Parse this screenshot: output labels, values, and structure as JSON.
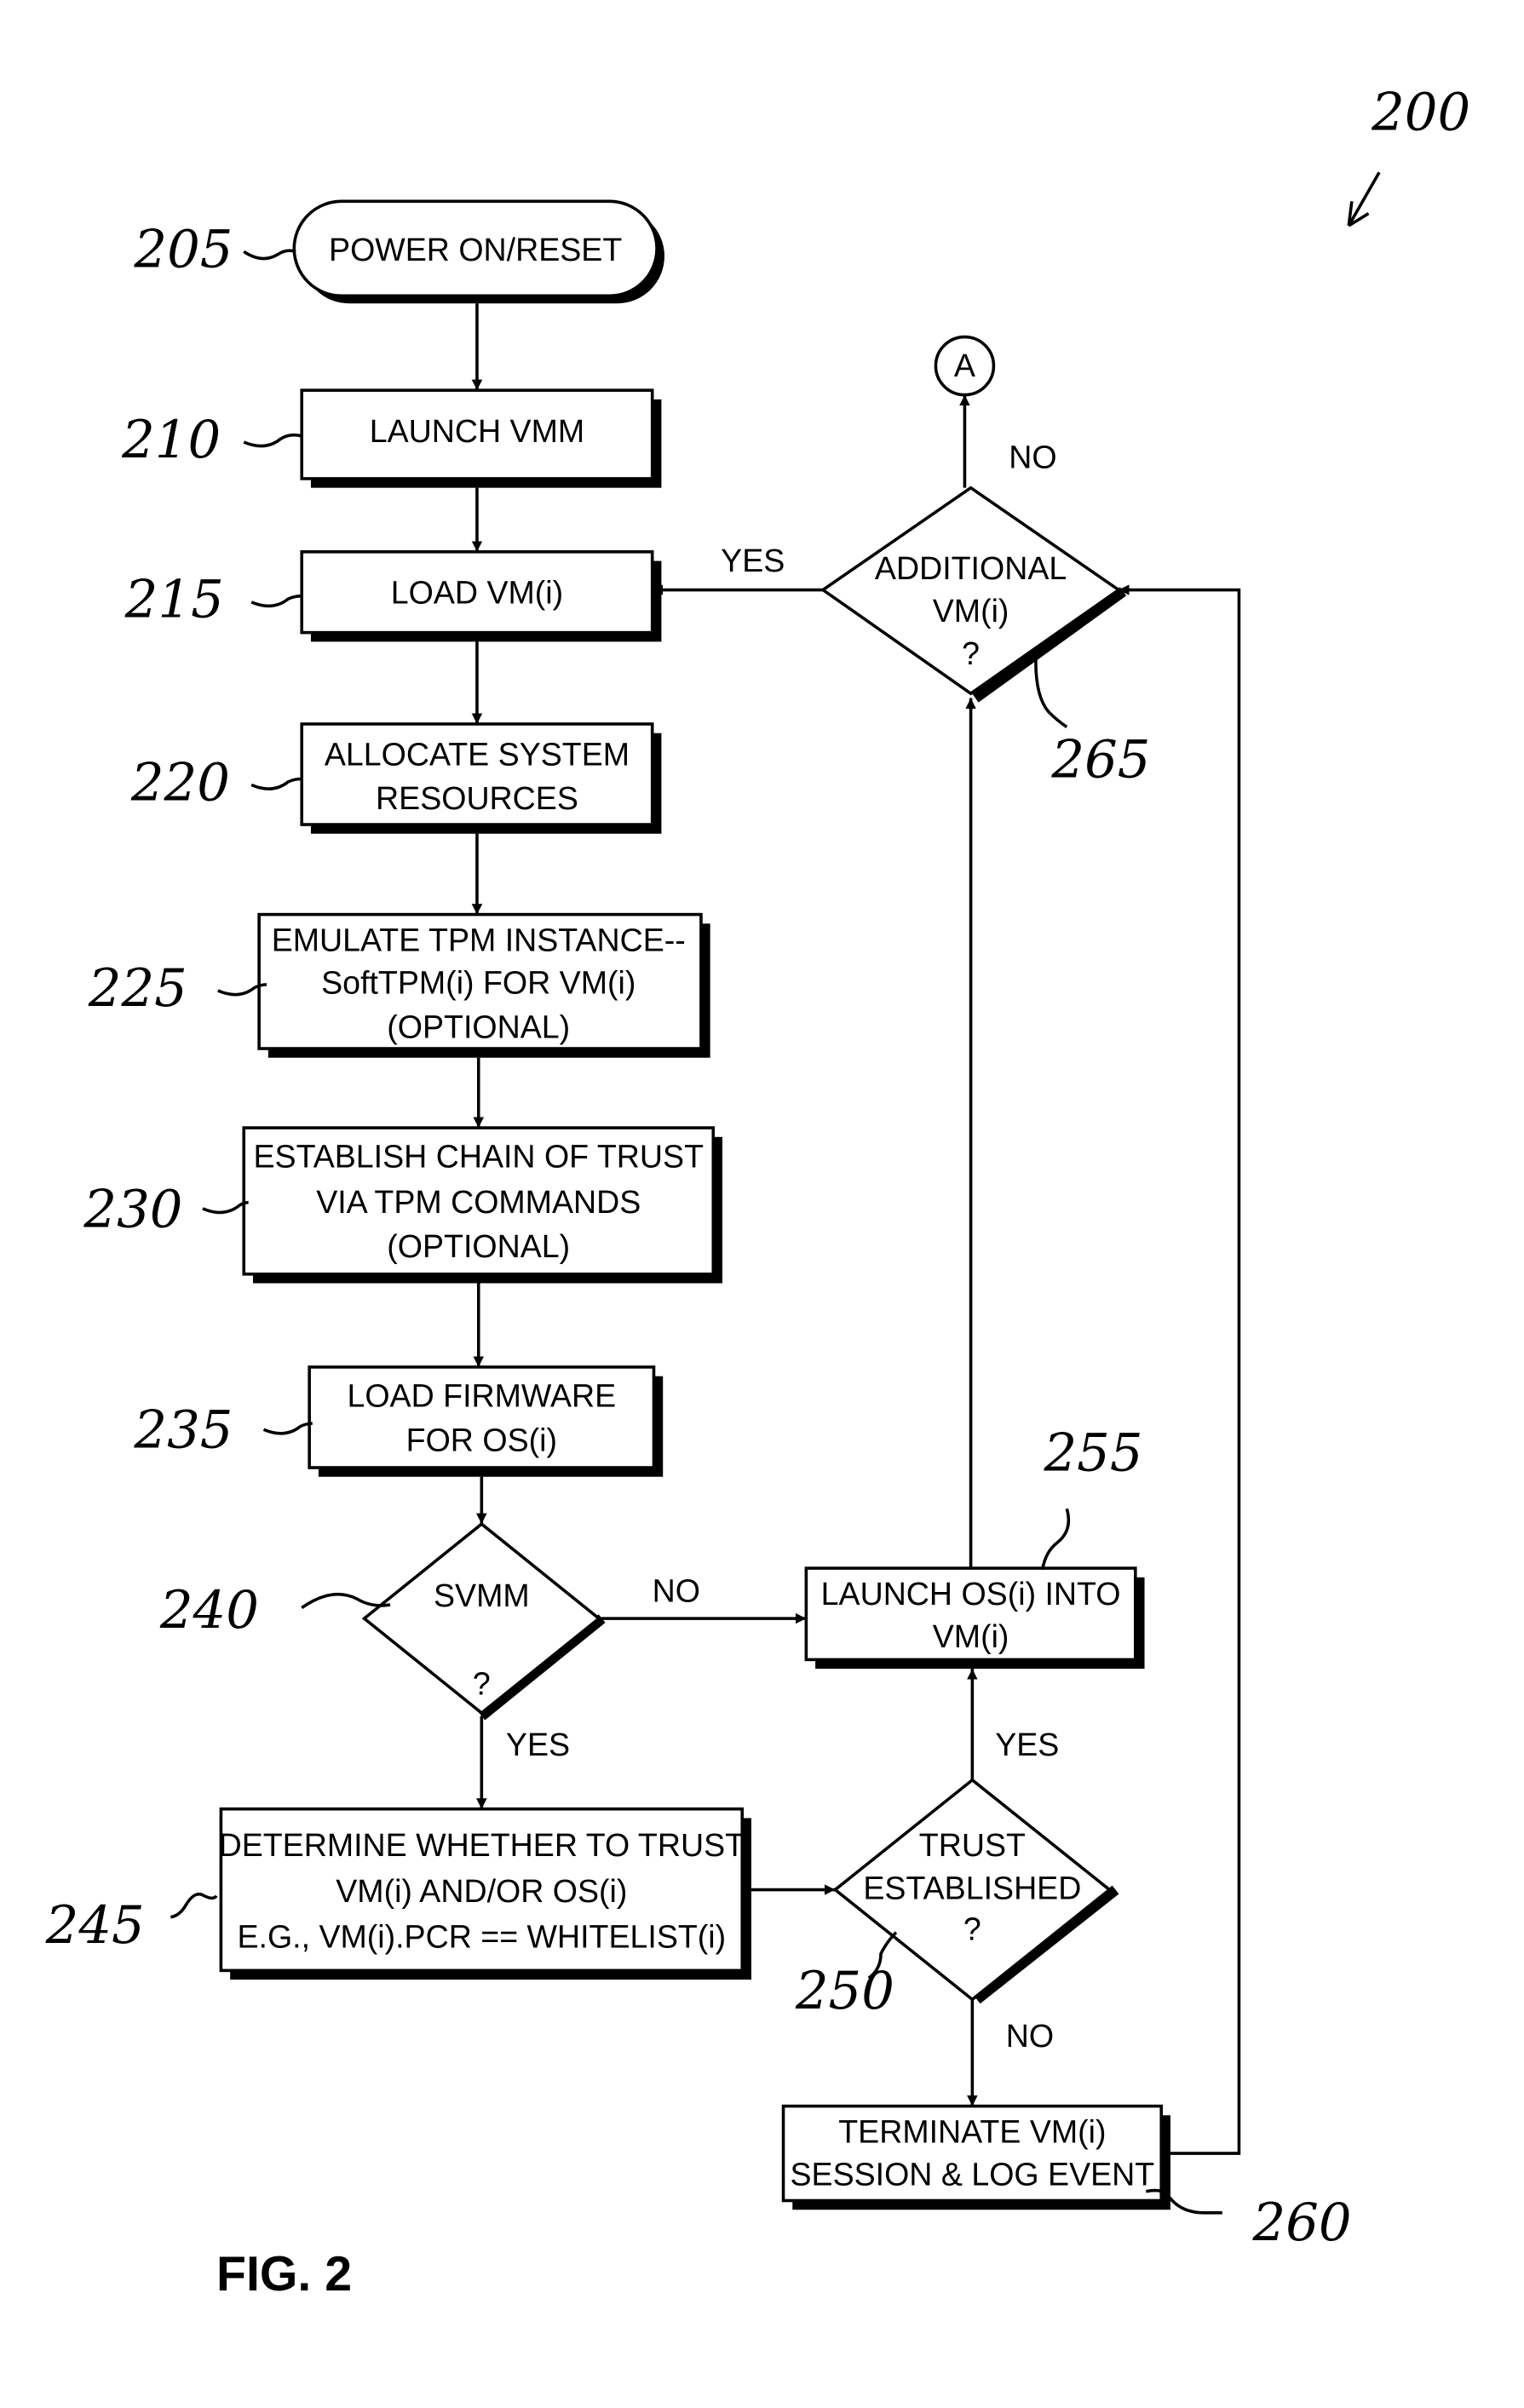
{
  "diagram": {
    "figure_ref": "200",
    "figure_caption": "FIG. 2",
    "nodes": {
      "n205": {
        "ref": "205",
        "lines": [
          "POWER ON/RESET"
        ]
      },
      "n210": {
        "ref": "210",
        "lines": [
          "LAUNCH VMM"
        ]
      },
      "n215": {
        "ref": "215",
        "lines": [
          "LOAD VM(i)"
        ]
      },
      "n220": {
        "ref": "220",
        "lines": [
          "ALLOCATE SYSTEM",
          "RESOURCES"
        ]
      },
      "n225": {
        "ref": "225",
        "lines": [
          "EMULATE TPM INSTANCE--",
          "SoftTPM(i) FOR VM(i)",
          "(OPTIONAL)"
        ]
      },
      "n230": {
        "ref": "230",
        "lines": [
          "ESTABLISH CHAIN OF TRUST",
          "VIA TPM COMMANDS",
          "(OPTIONAL)"
        ]
      },
      "n235": {
        "ref": "235",
        "lines": [
          "LOAD FIRMWARE",
          "FOR OS(i)"
        ]
      },
      "n240": {
        "ref": "240",
        "lines": [
          "SVMM",
          "?"
        ]
      },
      "n245": {
        "ref": "245",
        "lines": [
          "DETERMINE WHETHER TO TRUST",
          "VM(i) AND/OR OS(i)",
          "E.G., VM(i).PCR == WHITELIST(i)"
        ]
      },
      "n250": {
        "ref": "250",
        "lines": [
          "TRUST",
          "ESTABLISHED",
          "?"
        ]
      },
      "n255": {
        "ref": "255",
        "lines": [
          "LAUNCH OS(i) INTO",
          "VM(i)"
        ]
      },
      "n260": {
        "ref": "260",
        "lines": [
          "TERMINATE VM(i)",
          "SESSION & LOG EVENT"
        ]
      },
      "n265": {
        "ref": "265",
        "lines": [
          "ADDITIONAL",
          "VM(i)",
          "?"
        ]
      },
      "connA": {
        "label": "A"
      }
    },
    "edge_labels": {
      "e240_no": "NO",
      "e240_yes": "YES",
      "e250_yes": "YES",
      "e250_no": "NO",
      "e265_yes": "YES",
      "e265_no": "NO"
    }
  }
}
